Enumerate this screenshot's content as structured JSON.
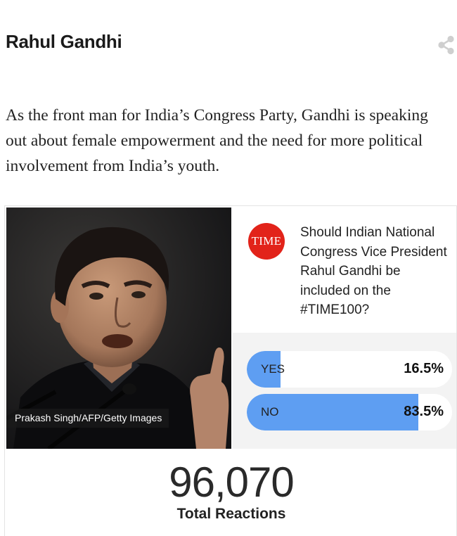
{
  "header": {
    "title": "Rahul Gandhi",
    "share_icon": "share-icon"
  },
  "intro": "As the front man for India’s Congress Party, Gandhi is speaking out about female empowerment and the need for more political involvement from India’s youth.",
  "poll": {
    "photo_caption": "Prakash Singh/AFP/Getty Images",
    "brand_logo_text": "TIME",
    "question": "Should Indian National Congress Vice President Rahul Gandhi be included on the #TIME100?",
    "options": [
      {
        "label": "YES",
        "percent_text": "16.5%",
        "percent": 16.5
      },
      {
        "label": "NO",
        "percent_text": "83.5%",
        "percent": 83.5
      }
    ],
    "total_count": "96,070",
    "total_label": "Total Reactions",
    "colors": {
      "bar": "#5e9ef2",
      "brand": "#e2231a",
      "panel": "#f3f3f3"
    }
  }
}
